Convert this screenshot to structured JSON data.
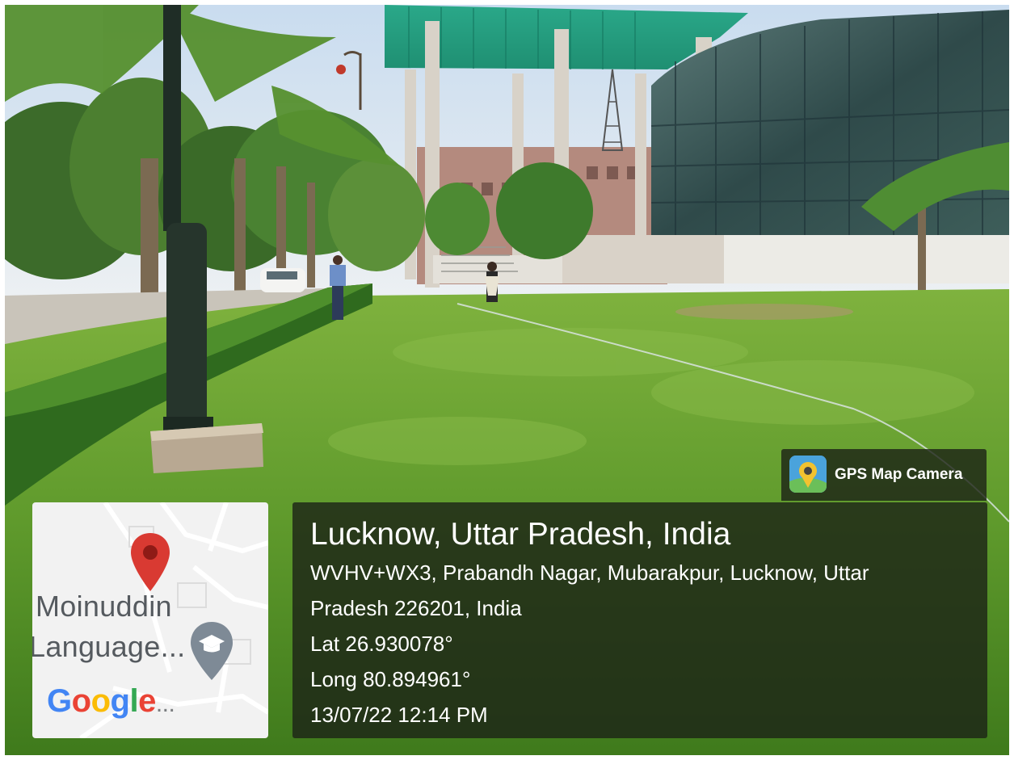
{
  "watermark": {
    "app_name": "GPS Map Camera",
    "app_icon": "camera-location-pin-icon"
  },
  "location": {
    "title": "Lucknow, Uttar Pradesh, India",
    "address_line1": "WVHV+WX3, Prabandh Nagar, Mubarakpur, Lucknow, Uttar",
    "address_line2": "Pradesh 226201, India",
    "latitude": "Lat 26.930078°",
    "longitude": "Long 80.894961°",
    "timestamp": "13/07/22 12:14 PM"
  },
  "map": {
    "place_line1": "Moinuddin",
    "place_line2": "Language...",
    "brand": [
      "G",
      "o",
      "o",
      "g",
      "l",
      "e"
    ],
    "brand_suffix": "...",
    "brand_colors": [
      "#4285F4",
      "#EA4335",
      "#FBBC05",
      "#4285F4",
      "#34A853",
      "#EA4335"
    ],
    "pin_icon": "location-pin-icon",
    "poi_icon": "graduation-cap-icon"
  },
  "colors": {
    "pin": "#d93a32",
    "lawn": "#5e9a2b",
    "panel": "#1c2216"
  }
}
